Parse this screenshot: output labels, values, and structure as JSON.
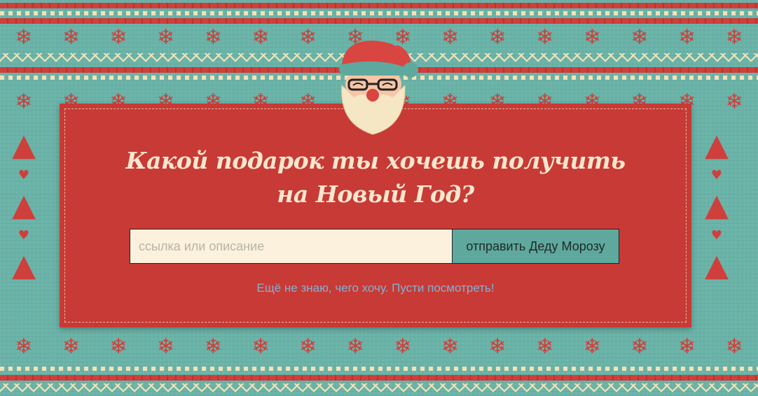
{
  "page": {
    "heading_line1": "Какой подарок ты хочешь получить",
    "heading_line2": "на Новый Год?"
  },
  "form": {
    "input_value": "",
    "input_placeholder": "ссылка или описание",
    "submit_label": "отправить Деду Морозу"
  },
  "browse_link": "Ещё не знаю, чего хочу. Пусти посмотреть!",
  "colors": {
    "background": "#6ab3a8",
    "card": "#c83a35",
    "cream": "#f3e2b8",
    "button": "#5fa89d",
    "link": "#7fb3d8"
  },
  "icons": {
    "snowflake": "❄",
    "tree": "▲",
    "heart": "♥"
  }
}
